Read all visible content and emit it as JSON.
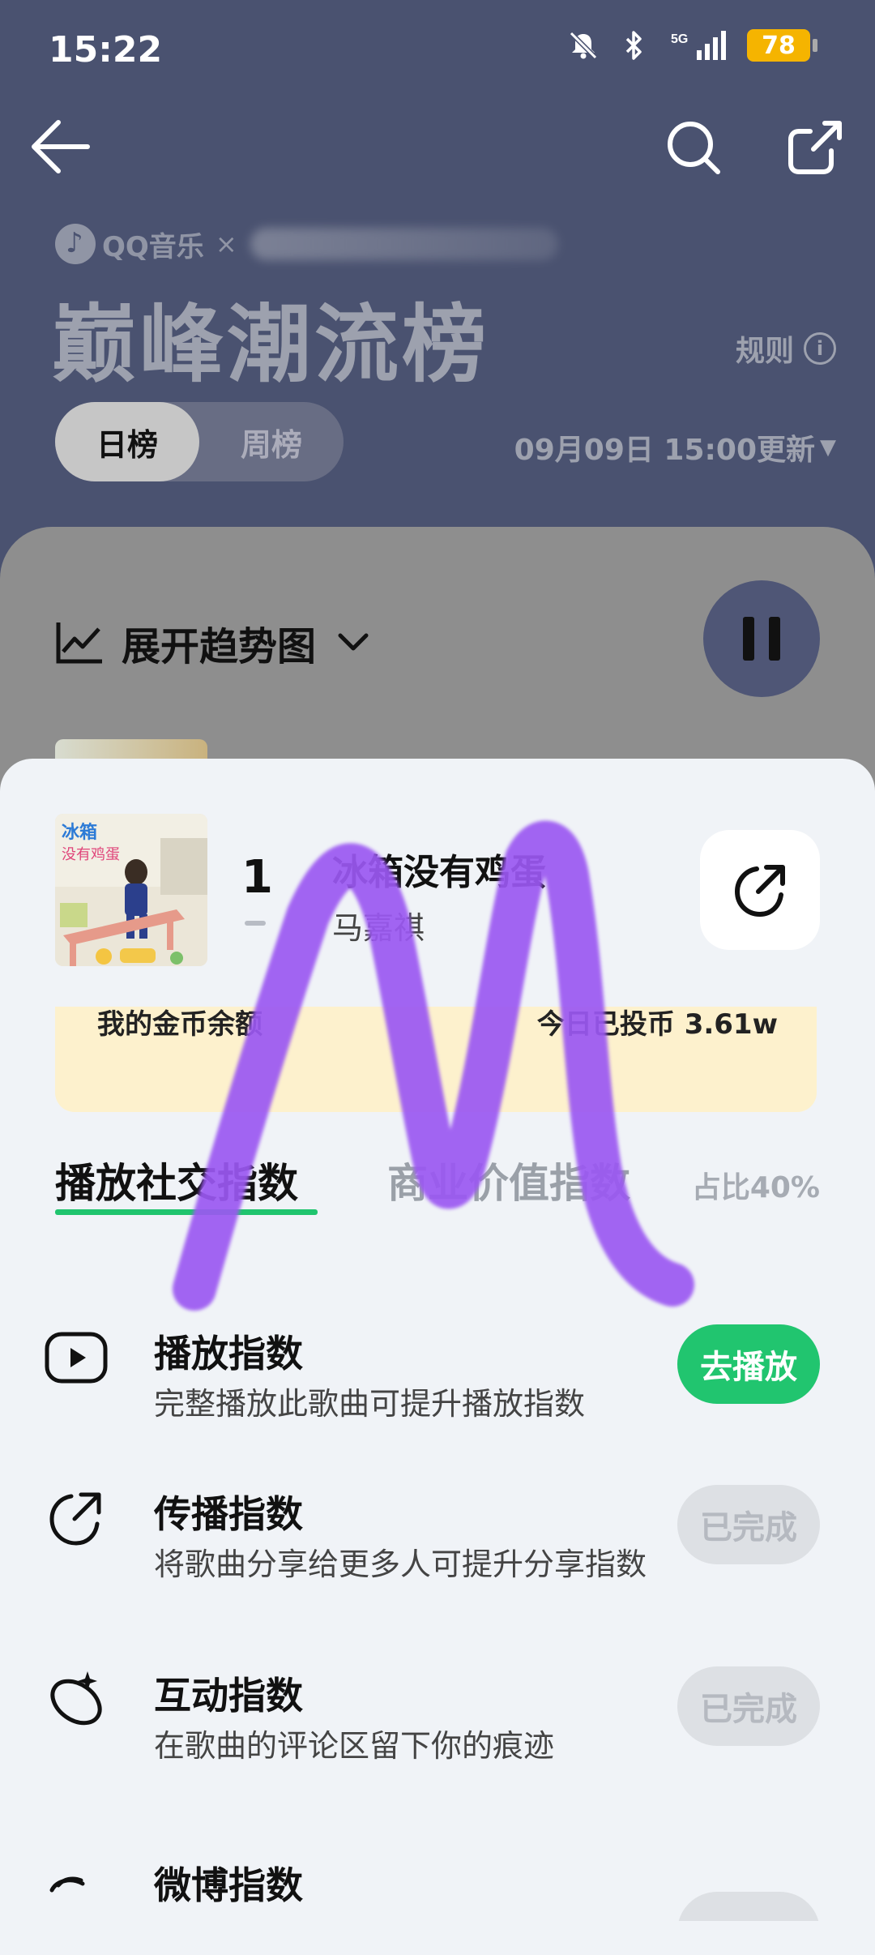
{
  "status_bar": {
    "time": "15:22",
    "network": "5G",
    "battery": "78",
    "icons": [
      "mute-bell-icon",
      "bluetooth-icon",
      "signal-5g-icon",
      "battery-icon"
    ]
  },
  "header": {
    "brand_name": "QQ音乐",
    "brand_separator": "×",
    "title": "巅峰潮流榜",
    "rules_label": "规则",
    "rules_icon_glyph": "i",
    "tabs": [
      {
        "label": "日榜",
        "active": true
      },
      {
        "label": "周榜",
        "active": false
      }
    ],
    "updated_label": "09月09日 15:00更新",
    "updated_caret": "▼"
  },
  "trend": {
    "label": "展开趋势图"
  },
  "sheet": {
    "song": {
      "rank": "1",
      "title": "冰箱没有鸡蛋",
      "artist": "马嘉祺"
    },
    "coins": {
      "left_label": "我的金币余额",
      "right_label": "今日已投币 3.61w"
    },
    "index_tabs": {
      "active": "播放社交指数",
      "inactive": "商业价值指数",
      "percent": "占比40%"
    },
    "tasks": [
      {
        "title": "播放指数",
        "desc": "完整播放此歌曲可提升播放指数",
        "button": "去播放",
        "done": false,
        "icon": "play-box-icon"
      },
      {
        "title": "传播指数",
        "desc": "将歌曲分享给更多人可提升分享指数",
        "button": "已完成",
        "done": true,
        "icon": "share-arrow-icon"
      },
      {
        "title": "互动指数",
        "desc": "在歌曲的评论区留下你的痕迹",
        "button": "已完成",
        "done": true,
        "icon": "comment-sparkle-icon"
      },
      {
        "title": "微博指数",
        "desc": "",
        "button": "",
        "done": true,
        "icon": "weibo-icon"
      }
    ]
  },
  "colors": {
    "header_bg": "#4a5270",
    "accent_green": "#21c56f",
    "underline_green": "#20c46e",
    "battery": "#f5b400",
    "scribble": "#9b59f2",
    "coin_panel": "#fdf1cd"
  }
}
